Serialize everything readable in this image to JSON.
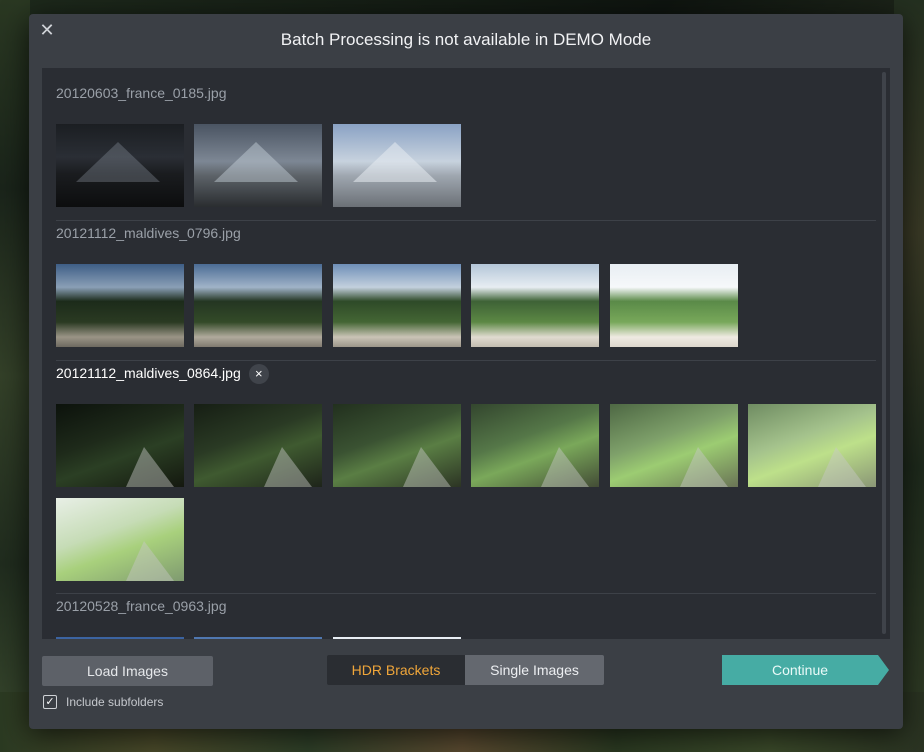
{
  "dialog": {
    "title": "Batch Processing is not available in DEMO Mode",
    "close_icon": "close-icon"
  },
  "groups": [
    {
      "name": "20120603_france_0185.jpg",
      "selected": false,
      "thumb_count": 3
    },
    {
      "name": "20121112_maldives_0796.jpg",
      "selected": false,
      "thumb_count": 5
    },
    {
      "name": "20121112_maldives_0864.jpg",
      "selected": true,
      "thumb_count": 7,
      "remove_icon": "×"
    },
    {
      "name": "20120528_france_0963.jpg",
      "selected": false,
      "thumb_count": 3
    }
  ],
  "footer": {
    "load_images_label": "Load Images",
    "mode_hdr_label": "HDR Brackets",
    "mode_single_label": "Single Images",
    "active_mode": "HDR Brackets",
    "continue_label": "Continue",
    "include_subfolders_label": "Include subfolders",
    "include_subfolders_checked": true,
    "check_glyph": "✓"
  },
  "colors": {
    "accent_continue": "#46aca4",
    "active_mode_text": "#f0a63a",
    "dialog_bg": "#3b3f45",
    "panel_bg": "#2a2d33"
  }
}
